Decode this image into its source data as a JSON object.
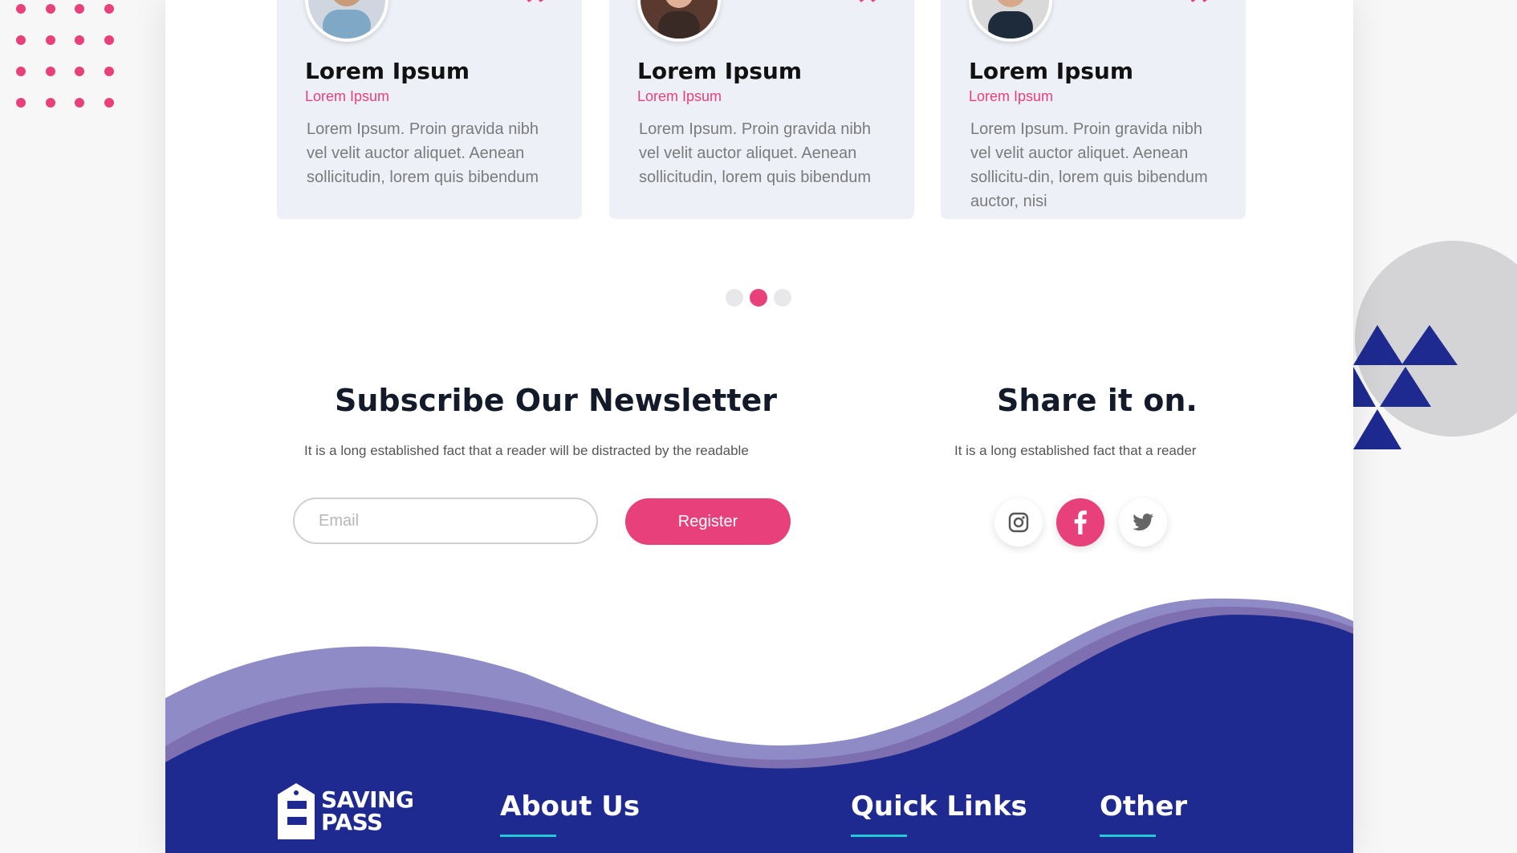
{
  "colors": {
    "accent_pink": "#e8407a",
    "footer_navy": "#1e2a8f",
    "wave_lavender": "#8f8bc6",
    "card_bg": "#edf0f6",
    "underline_teal": "#22c9d6"
  },
  "testimonials": [
    {
      "name": "Lorem Ipsum",
      "role": "Lorem Ipsum",
      "text": "Lorem Ipsum. Proin gravida nibh vel velit auctor aliquet. Aenean sollicitudin, lorem quis bibendum",
      "quote_icon": "quote-icon",
      "avatar": "avatar"
    },
    {
      "name": "Lorem Ipsum",
      "role": "Lorem Ipsum",
      "text": "Lorem Ipsum. Proin gravida nibh vel velit auctor aliquet. Aenean sollicitudin, lorem quis bibendum",
      "quote_icon": "quote-icon",
      "avatar": "avatar"
    },
    {
      "name": "Lorem Ipsum",
      "role": "Lorem Ipsum",
      "text": "Lorem Ipsum. Proin gravida nibh vel velit auctor aliquet. Aenean sollicitu-din, lorem quis bibendum auctor, nisi",
      "quote_icon": "quote-icon",
      "avatar": "avatar"
    }
  ],
  "pager": {
    "count": 3,
    "active_index": 1
  },
  "newsletter": {
    "title": "Subscribe Our Newsletter",
    "subtitle": "It is a long established fact that a reader will be distracted by the readable",
    "email_placeholder": "Email",
    "register_label": "Register"
  },
  "share": {
    "title": "Share it on.",
    "subtitle": "It is a long established fact that a reader",
    "icons": [
      "instagram-icon",
      "facebook-icon",
      "twitter-icon"
    ],
    "active_icon": "facebook-icon"
  },
  "footer": {
    "logo_line1": "SAVING",
    "logo_line2": "PASS",
    "columns": [
      "About Us",
      "Quick Links",
      "Other"
    ]
  }
}
